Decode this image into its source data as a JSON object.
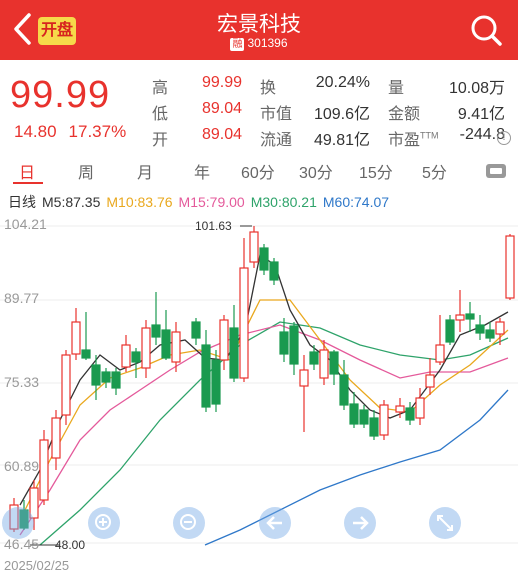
{
  "header": {
    "title": "宏景科技",
    "badge": "融",
    "code": "301396",
    "kaipan": "开盘"
  },
  "quote": {
    "price": "99.99",
    "change": "14.80",
    "change_pct": "17.37%",
    "stats": [
      {
        "label": "高",
        "value": "99.99"
      },
      {
        "label": "低",
        "value": "89.04"
      },
      {
        "label": "开",
        "value": "89.04"
      },
      {
        "label": "换",
        "value": "20.24%"
      },
      {
        "label": "市值",
        "value": "109.6亿"
      },
      {
        "label": "流通",
        "value": "49.81亿"
      },
      {
        "label": "量",
        "value": "10.08万"
      },
      {
        "label": "金额",
        "value": "9.41亿"
      },
      {
        "label": "市盈",
        "label_tm": "TTM",
        "value": "-244.8"
      }
    ]
  },
  "tabs": [
    "日",
    "周",
    "月",
    "年",
    "60分",
    "30分",
    "15分",
    "5分"
  ],
  "ma": {
    "name": "日线",
    "m5": "M5:87.35",
    "m10": "M10:83.76",
    "m15": "M15:79.00",
    "m30": "M30:80.21",
    "m60": "M60:74.07"
  },
  "colors": {
    "up": "#e8322d",
    "down": "#1a9a4f",
    "m5": "#333333",
    "m10": "#e9a81e",
    "m15": "#e45a9b",
    "m30": "#2ea36a",
    "m60": "#2f78c9"
  },
  "chart": {
    "y_labels": [
      "104.21",
      "89.77",
      "75.33",
      "60.89",
      "46.45"
    ],
    "high_annotation": "101.63",
    "low_annotation": "48.00",
    "date": "2025/02/25"
  }
}
